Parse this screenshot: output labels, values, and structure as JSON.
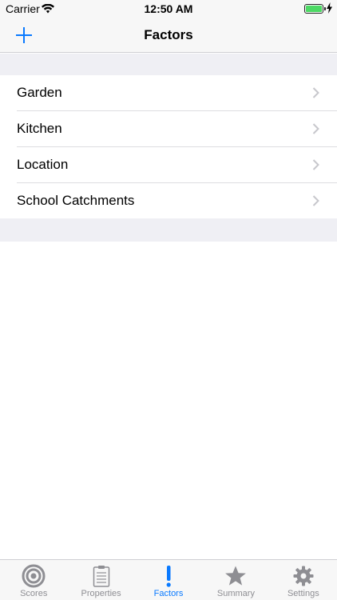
{
  "status_bar": {
    "carrier": "Carrier",
    "time": "12:50 AM"
  },
  "nav": {
    "title": "Factors",
    "add_icon": "plus-icon"
  },
  "factors": [
    {
      "label": "Garden"
    },
    {
      "label": "Kitchen"
    },
    {
      "label": "Location"
    },
    {
      "label": "School Catchments"
    }
  ],
  "tabs": [
    {
      "label": "Scores",
      "icon": "target-icon",
      "active": false
    },
    {
      "label": "Properties",
      "icon": "clipboard-icon",
      "active": false
    },
    {
      "label": "Factors",
      "icon": "exclamation-icon",
      "active": true
    },
    {
      "label": "Summary",
      "icon": "star-icon",
      "active": false
    },
    {
      "label": "Settings",
      "icon": "gear-icon",
      "active": false
    }
  ],
  "colors": {
    "accent": "#0a7aff",
    "inactive": "#8e8e93",
    "battery": "#4cd964"
  }
}
